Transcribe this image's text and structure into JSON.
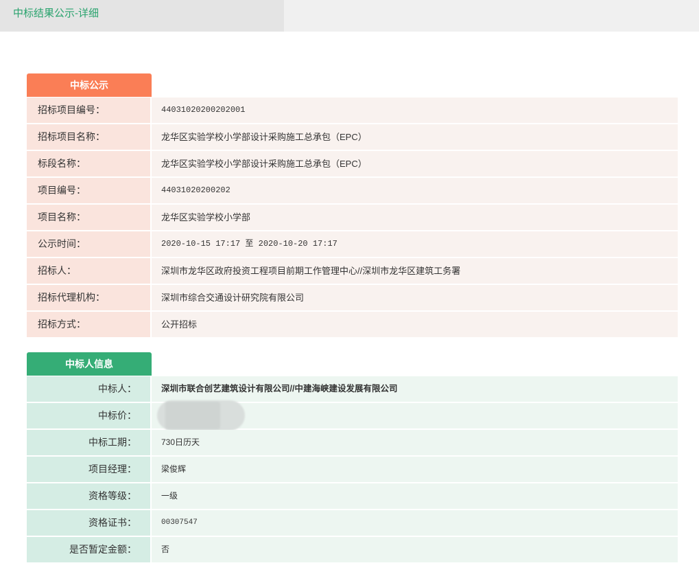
{
  "header": {
    "title": "中标结果公示-详细"
  },
  "section1": {
    "title": "中标公示",
    "rows": [
      {
        "label": "招标项目编号：",
        "value": "44031020200202001"
      },
      {
        "label": "招标项目名称：",
        "value": "龙华区实验学校小学部设计采购施工总承包（EPC）"
      },
      {
        "label": "标段名称：",
        "value": "龙华区实验学校小学部设计采购施工总承包（EPC）"
      },
      {
        "label": "项目编号：",
        "value": "44031020200202"
      },
      {
        "label": "项目名称：",
        "value": "龙华区实验学校小学部"
      },
      {
        "label": "公示时间：",
        "value": "2020-10-15 17:17 至 2020-10-20 17:17"
      },
      {
        "label": "招标人：",
        "value": "深圳市龙华区政府投资工程项目前期工作管理中心//深圳市龙华区建筑工务署"
      },
      {
        "label": "招标代理机构：",
        "value": "深圳市综合交通设计研究院有限公司"
      },
      {
        "label": "招标方式：",
        "value": "公开招标"
      }
    ]
  },
  "section2": {
    "title": "中标人信息",
    "rows": [
      {
        "label": "中标人：",
        "value": "深圳市联合创艺建筑设计有限公司//中建海峡建设发展有限公司"
      },
      {
        "label": "中标价：",
        "value": ""
      },
      {
        "label": "中标工期：",
        "value": "730日历天"
      },
      {
        "label": "项目经理：",
        "value": "梁俊辉"
      },
      {
        "label": "资格等级：",
        "value": "一级"
      },
      {
        "label": "资格证书：",
        "value": "00307547"
      },
      {
        "label": "是否暂定金额：",
        "value": "否"
      }
    ]
  }
}
